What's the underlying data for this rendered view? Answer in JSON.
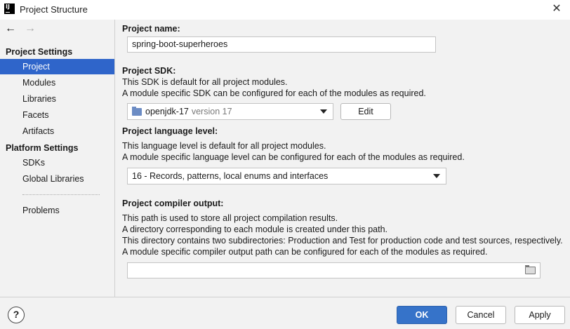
{
  "window": {
    "title": "Project Structure",
    "app_icon_label": "IJ",
    "close_glyph": "✕"
  },
  "nav": {
    "back_glyph": "←",
    "forward_glyph": "→"
  },
  "sidebar": {
    "project_settings_header": "Project Settings",
    "project_settings_items": [
      {
        "label": "Project",
        "selected": true
      },
      {
        "label": "Modules",
        "selected": false
      },
      {
        "label": "Libraries",
        "selected": false
      },
      {
        "label": "Facets",
        "selected": false
      },
      {
        "label": "Artifacts",
        "selected": false
      }
    ],
    "platform_settings_header": "Platform Settings",
    "platform_settings_items": [
      {
        "label": "SDKs"
      },
      {
        "label": "Global Libraries"
      }
    ],
    "problems_label": "Problems"
  },
  "main": {
    "project_name": {
      "label": "Project name:",
      "value": "spring-boot-superheroes"
    },
    "project_sdk": {
      "label": "Project SDK:",
      "desc_line1": "This SDK is default for all project modules.",
      "desc_line2": "A module specific SDK can be configured for each of the modules as required.",
      "selected_name": "openjdk-17",
      "selected_version": "version 17",
      "edit_label": "Edit"
    },
    "language_level": {
      "label": "Project language level:",
      "desc_line1": "This language level is default for all project modules.",
      "desc_line2": "A module specific language level can be configured for each of the modules as required.",
      "selected": "16 - Records, patterns, local enums and interfaces"
    },
    "compiler_output": {
      "label": "Project compiler output:",
      "desc_line1": "This path is used to store all project compilation results.",
      "desc_line2": "A directory corresponding to each module is created under this path.",
      "desc_line3": "This directory contains two subdirectories: Production and Test for production code and test sources, respectively.",
      "desc_line4": "A module specific compiler output path can be configured for each of the modules as required.",
      "value": ""
    }
  },
  "footer": {
    "help_glyph": "?",
    "ok_label": "OK",
    "cancel_label": "Cancel",
    "apply_label": "Apply"
  },
  "colors": {
    "selection": "#2f65ca",
    "primary_button": "#3673c9",
    "background": "#f2f2f2"
  }
}
